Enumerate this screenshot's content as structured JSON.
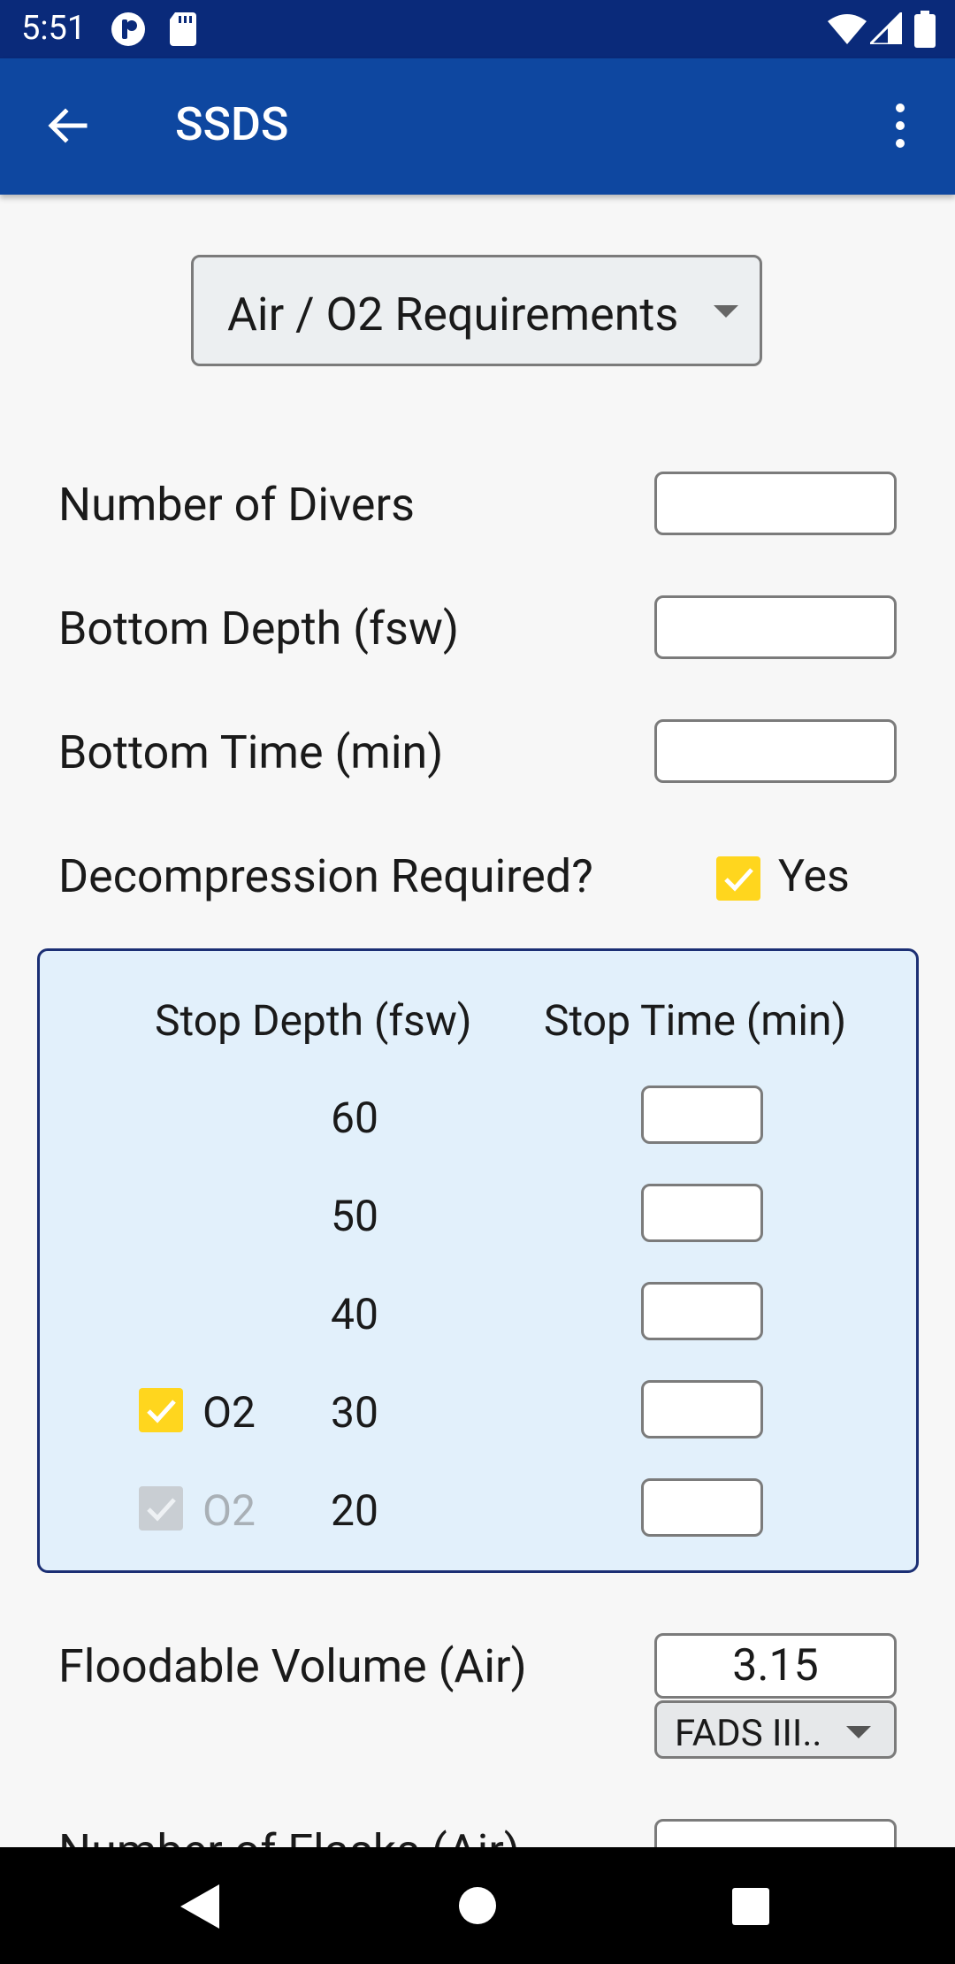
{
  "status_bar": {
    "time": "5:51"
  },
  "app_bar": {
    "title": "SSDS"
  },
  "calculator_select": {
    "value": "Air / O2 Requirements"
  },
  "form": {
    "divers_label": "Number of Divers",
    "divers_value": "",
    "depth_label": "Bottom Depth (fsw)",
    "depth_value": "",
    "time_label": "Bottom Time (min)",
    "time_value": "",
    "decomp_label": "Decompression Required?",
    "decomp_yes": "Yes"
  },
  "decompression": {
    "col_depth": "Stop Depth (fsw)",
    "col_time": "Stop Time (min)",
    "stops": [
      {
        "depth": "60",
        "o2_label": "",
        "time": ""
      },
      {
        "depth": "50",
        "o2_label": "",
        "time": ""
      },
      {
        "depth": "40",
        "o2_label": "",
        "time": ""
      },
      {
        "depth": "30",
        "o2_label": "O2",
        "time": ""
      },
      {
        "depth": "20",
        "o2_label": "O2",
        "time": ""
      }
    ]
  },
  "floodable": {
    "label": "Floodable Volume (Air)",
    "value": "3.15",
    "unit_select": "FADS III.."
  },
  "next_row": {
    "label": "Number of Flasks (Air)"
  },
  "colors": {
    "status_bar": "#0a2a7a",
    "app_bar": "#0e47a0",
    "checkbox_accent": "#ffd61e",
    "panel_bg": "#e2f0fb",
    "panel_border": "#1b2f74"
  }
}
